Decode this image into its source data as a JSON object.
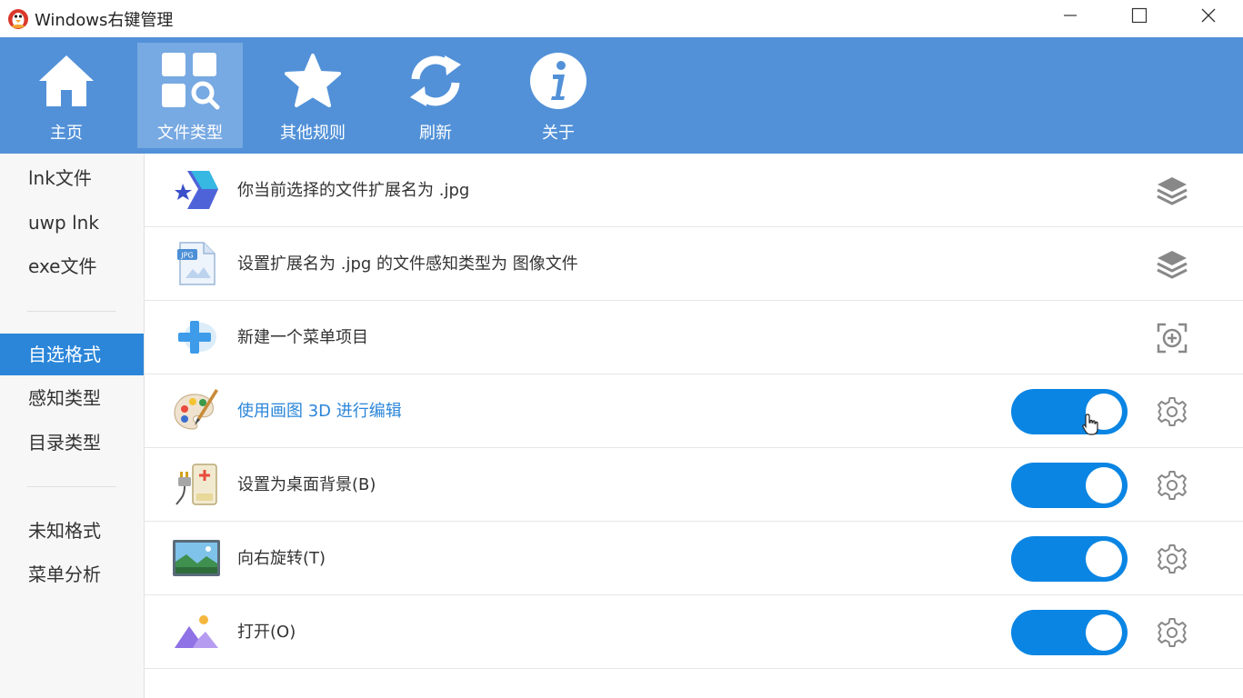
{
  "window": {
    "title": "Windows右键管理"
  },
  "toolbar": {
    "items": [
      {
        "label": "主页",
        "icon": "home-icon"
      },
      {
        "label": "文件类型",
        "icon": "file-type-icon",
        "active": true
      },
      {
        "label": "其他规则",
        "icon": "star-icon"
      },
      {
        "label": "刷新",
        "icon": "refresh-icon"
      },
      {
        "label": "关于",
        "icon": "info-icon"
      }
    ]
  },
  "sidebar": {
    "items": [
      {
        "label": "lnk文件"
      },
      {
        "label": "uwp lnk"
      },
      {
        "label": "exe文件"
      },
      {
        "label": "自选格式",
        "active": true
      },
      {
        "label": "感知类型"
      },
      {
        "label": "目录类型"
      },
      {
        "label": "未知格式"
      },
      {
        "label": "菜单分析"
      }
    ]
  },
  "content": {
    "rows": [
      {
        "text": "你当前选择的文件扩展名为 .jpg",
        "icon": "extension-icon",
        "action": "layers-icon"
      },
      {
        "text": "设置扩展名为 .jpg 的文件感知类型为 图像文件",
        "icon": "jpg-file-icon",
        "action": "layers-icon"
      },
      {
        "text": "新建一个菜单项目",
        "icon": "add-icon",
        "action": "add-frame-icon"
      },
      {
        "text": "使用画图 3D 进行编辑",
        "icon": "palette-icon",
        "toggle": true,
        "enabled": true,
        "action": "gear-icon"
      },
      {
        "text": "设置为桌面背景(B)",
        "icon": "wallpaper-icon",
        "toggle": true,
        "enabled": true,
        "action": "gear-icon"
      },
      {
        "text": "向右旋转(T)",
        "icon": "picture-icon",
        "toggle": true,
        "enabled": true,
        "action": "gear-icon"
      },
      {
        "text": "打开(O)",
        "icon": "photos-icon",
        "toggle": true,
        "enabled": true,
        "action": "gear-icon"
      }
    ]
  },
  "colors": {
    "toolbar_bg": "#5291d8",
    "toolbar_active": "#77a9e2",
    "accent": "#2b86d9",
    "toggle_on": "#0a85e3"
  }
}
